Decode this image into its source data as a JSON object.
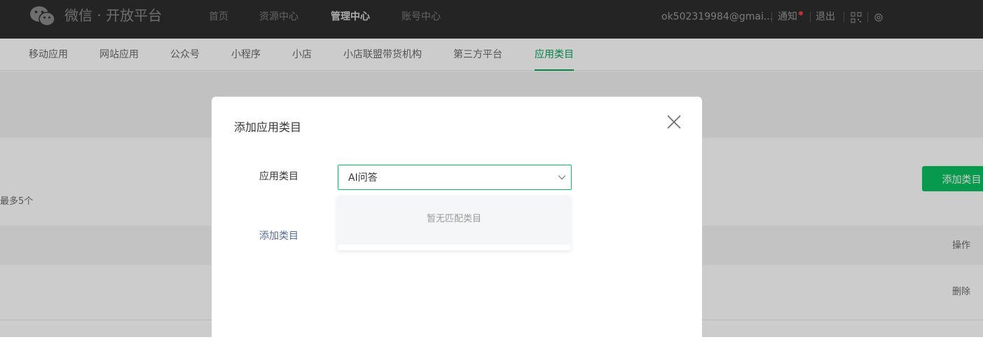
{
  "header": {
    "logo_text": "微信 · 开放平台",
    "nav": [
      "首页",
      "资源中心",
      "管理中心",
      "账号中心"
    ],
    "account": "ok502319984@gmai...",
    "notify": "通知",
    "logout": "退出"
  },
  "subnav": {
    "items": [
      "移动应用",
      "网站应用",
      "公众号",
      "小程序",
      "小店",
      "小店联盟带货机构",
      "第三方平台",
      "应用类目"
    ]
  },
  "page": {
    "limit_text": "最多5个",
    "add_button": "添加类目",
    "col_action": "操作",
    "row_delete": "删除"
  },
  "dialog": {
    "title": "添加应用类目",
    "field_label": "应用类目",
    "select_value": "AI问答",
    "empty_text": "暂无匹配类目",
    "add_link": "添加类目"
  },
  "colors": {
    "accent": "#07c160",
    "link": "#576b95",
    "topbar": "#2e2e2e"
  }
}
